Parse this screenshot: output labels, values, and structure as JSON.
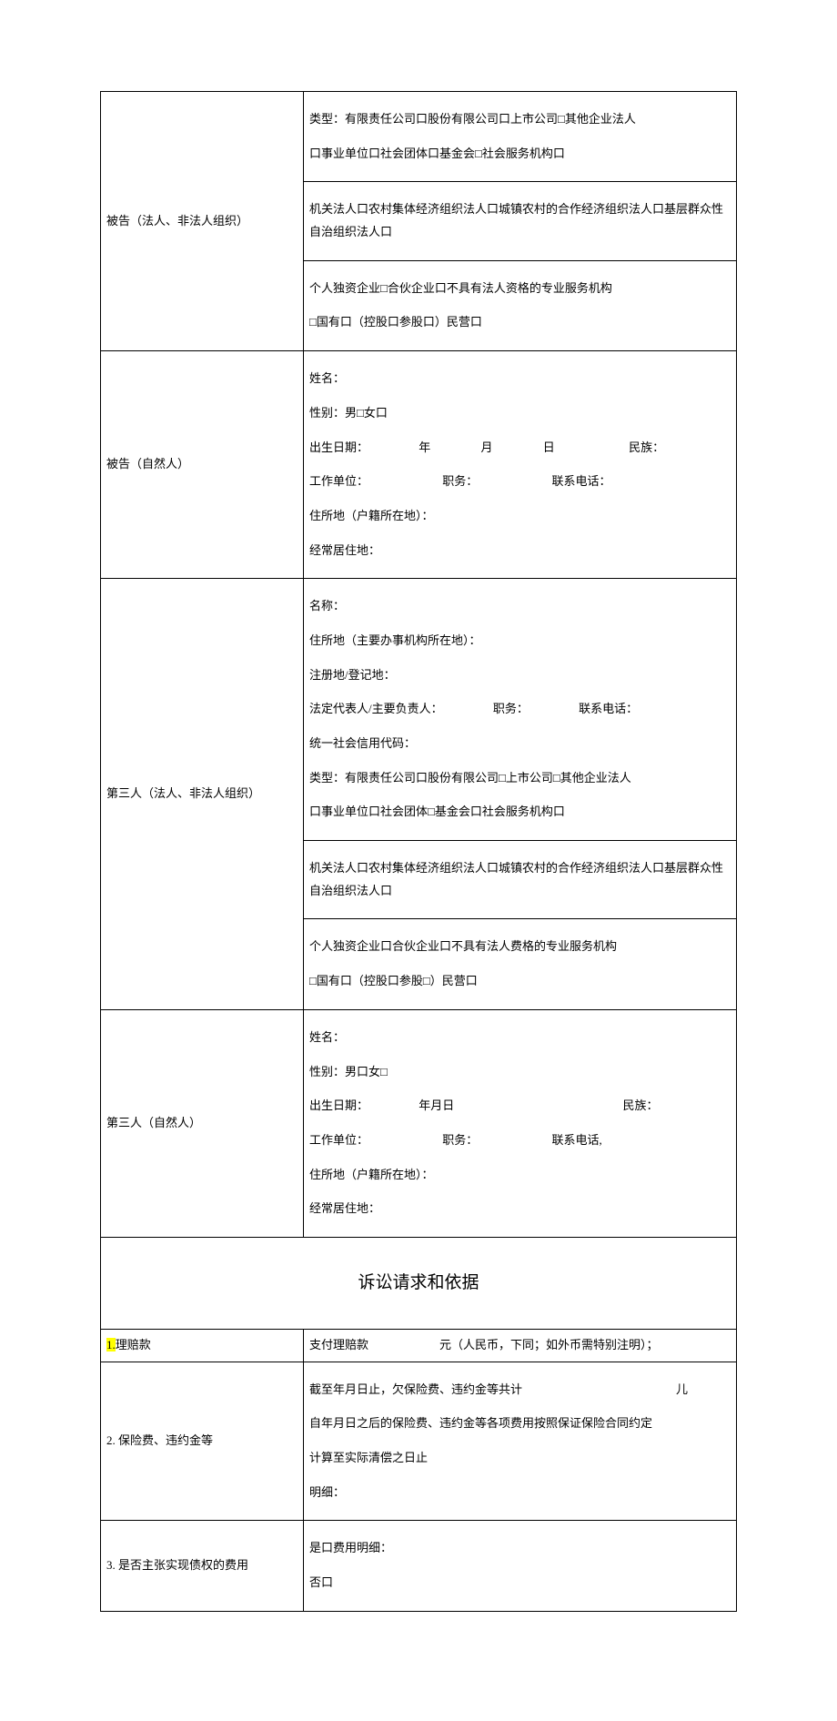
{
  "rows": {
    "defendant_org": {
      "label": "被告（法人、非法人组织）",
      "type_line1": "类型：有限责任公司口股份有限公司口上市公司□其他企业法人",
      "type_line2": "口事业单位口社会团体口基金会□社会服务机构口",
      "type_line3": "机关法人口农村集体经济组织法人口城镇农村的合作经济组织法人口基层群众性自治组织法人口",
      "type_line4": "个人独资企业□合伙企业口不具有法人资格的专业服务机构",
      "type_line5": "□国有口（控股口参股口）民营口"
    },
    "defendant_person": {
      "label": "被告（自然人）",
      "name": "姓名：",
      "gender": "性别：男□女口",
      "dob_prefix": "出生日期：",
      "year": "年",
      "month": "月",
      "day": "日",
      "ethnic": "民族：",
      "work": "工作单位：",
      "position": "职务：",
      "phone": "联系电话：",
      "addr": "住所地（户籍所在地）：",
      "residence": "经常居住地："
    },
    "third_org": {
      "label": "第三人（法人、非法人组织）",
      "name": "名称：",
      "addr": "住所地（主要办事机构所在地）：",
      "reg": "注册地/登记地：",
      "legal_rep": "法定代表人/主要负责人：",
      "position": "职务：",
      "phone": "联系电话：",
      "credit": "统一社会信用代码：",
      "type_line1": "类型：有限责任公司口股份有限公司□上市公司□其他企业法人",
      "type_line2": "口事业单位口社会团体□基金会口社会服务机构口",
      "type_line3": "机关法人口农村集体经济组织法人口城镇农村的合作经济组织法人口基层群众性自治组织法人口",
      "type_line4": "个人独资企业口合伙企业口不具有法人费格的专业服务机构",
      "type_line5": "□国有口（控股口参股□）民营口"
    },
    "third_person": {
      "label": "第三人（自然人）",
      "name": "姓名：",
      "gender": "性别：男口女□",
      "dob_prefix": "出生日期：",
      "ymd": "年月日",
      "ethnic": "民族：",
      "work": "工作单位：",
      "position": "职务：",
      "phone": "联系电话,",
      "addr": "住所地（户籍所在地）：",
      "residence": "经常居住地："
    }
  },
  "section_title": "诉讼请求和依据",
  "claims": {
    "r1": {
      "num": "1.",
      "label": "理赔款",
      "text_a": "支付理赔款",
      "text_b": "元（人民币，下同；如外币需特别注明）；"
    },
    "r2": {
      "label": "2. 保险费、违约金等",
      "line1a": "截至年月日止，欠保险费、违约金等共计",
      "line1b": "儿",
      "line2": "自年月日之后的保险费、违约金等各项费用按照保证保险合同约定",
      "line3": "计算至实际清偿之日止",
      "line4": "明细："
    },
    "r3": {
      "label": "3. 是否主张实现债权的费用",
      "yes": "是口费用明细：",
      "no": "否口"
    }
  }
}
